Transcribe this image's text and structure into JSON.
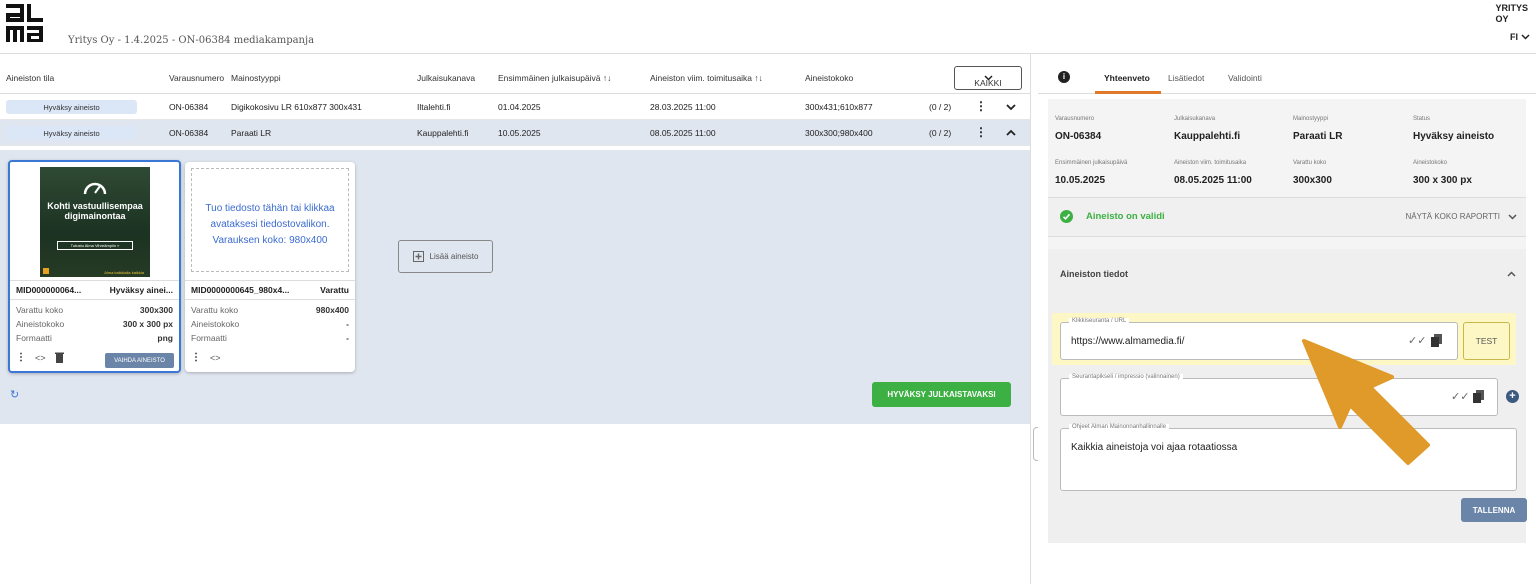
{
  "header": {
    "logo_text": "ALMA",
    "breadcrumb": "Yritys Oy - 1.4.2025 - ON-06384 mediakampanja",
    "company_line1": "YRITYS",
    "company_line2": "OY",
    "language": "FI"
  },
  "table": {
    "columns": [
      "Aineiston tila",
      "Varausnumero",
      "Mainostyyppi",
      "Julkaisukanava",
      "Ensimmäinen julkaisupäivä ↑↓",
      "Aineiston viim. toimitusaika ↑↓",
      "Aineistokoko"
    ],
    "filter_button": "KAIKKI",
    "rows": [
      {
        "status": "Hyväksy aineisto",
        "number": "ON-06384",
        "type": "Digikokosivu LR 610x877 300x431",
        "channel": "Iltalehti.fi",
        "first_date": "01.04.2025",
        "deadline": "28.03.2025 11:00",
        "size": "300x431;610x877",
        "count": "(0 / 2)"
      },
      {
        "status": "Hyväksy aineisto",
        "number": "ON-06384",
        "type": "Paraati LR",
        "channel": "Kauppalehti.fi",
        "first_date": "10.05.2025",
        "deadline": "08.05.2025 11:00",
        "size": "300x300;980x400",
        "count": "(0 / 2)"
      }
    ]
  },
  "cards": [
    {
      "title": "MID000000064...",
      "status": "Hyväksy ainei...",
      "thumb_title": "Kohti vastuullisempaa digimainontaa",
      "thumb_button": "Tutustu Alma Vihreämpiin »",
      "thumb_footer": "Alma kaikkialla kaikkia",
      "varattu_label": "Varattu koko",
      "varattu_value": "300x300",
      "koko_label": "Aineistokoko",
      "koko_value": "300 x 300 px",
      "format_label": "Formaatti",
      "format_value": "png",
      "replace_button": "VAIHDA AINEISTO"
    },
    {
      "title": "MID0000000645_980x4...",
      "status": "Varattu",
      "drop_text": "Tuo tiedosto tähän tai klikkaa avataksesi tiedostovalikon.",
      "drop_size": "Varauksen koko: 980x400",
      "varattu_label": "Varattu koko",
      "varattu_value": "980x400",
      "koko_label": "Aineistokoko",
      "koko_value": "-",
      "format_label": "Formaatti",
      "format_value": "-"
    }
  ],
  "add_material": "Lisää aineisto",
  "approve_button": "HYVÄKSY JULKAISTAVAKSI",
  "panel": {
    "tabs": [
      "Yhteenveto",
      "Lisätiedot",
      "Validointi"
    ],
    "summary": [
      {
        "label": "Varausnumero",
        "value": "ON-06384"
      },
      {
        "label": "Julkaisukanava",
        "value": "Kauppalehti.fi"
      },
      {
        "label": "Mainostyyppi",
        "value": "Paraati LR"
      },
      {
        "label": "Status",
        "value": "Hyväksy aineisto"
      },
      {
        "label": "Ensimmäinen julkaisupäivä",
        "value": "10.05.2025"
      },
      {
        "label": "Aineiston viim. toimitusaika",
        "value": "08.05.2025 11:00"
      },
      {
        "label": "Varattu koko",
        "value": "300x300"
      },
      {
        "label": "Aineistokoko",
        "value": "300 x 300 px"
      }
    ],
    "valid_text": "Aineisto on validi",
    "report_link": "NÄYTÄ KOKO RAPORTTI",
    "details_title": "Aineiston tiedot",
    "url_label": "Klikkiseuranta / URL",
    "url_value": "https://www.almamedia.fi/",
    "test_button": "TEST",
    "pixel_label": "Seurantapikseli / impressio (valinnainen)",
    "pixel_value": "",
    "notes_label": "Ohjeet Alman Mainonnanhallinnalle",
    "notes_value": "Kaikkia aineistoja voi ajaa rotaatiossa",
    "save_button": "TALLENNA"
  },
  "colors": {
    "accent": "#e07a2a",
    "valid": "#3cb043",
    "primary": "#6b85a8",
    "highlight": "#fdf7c6",
    "arrow": "#e09a2a"
  }
}
